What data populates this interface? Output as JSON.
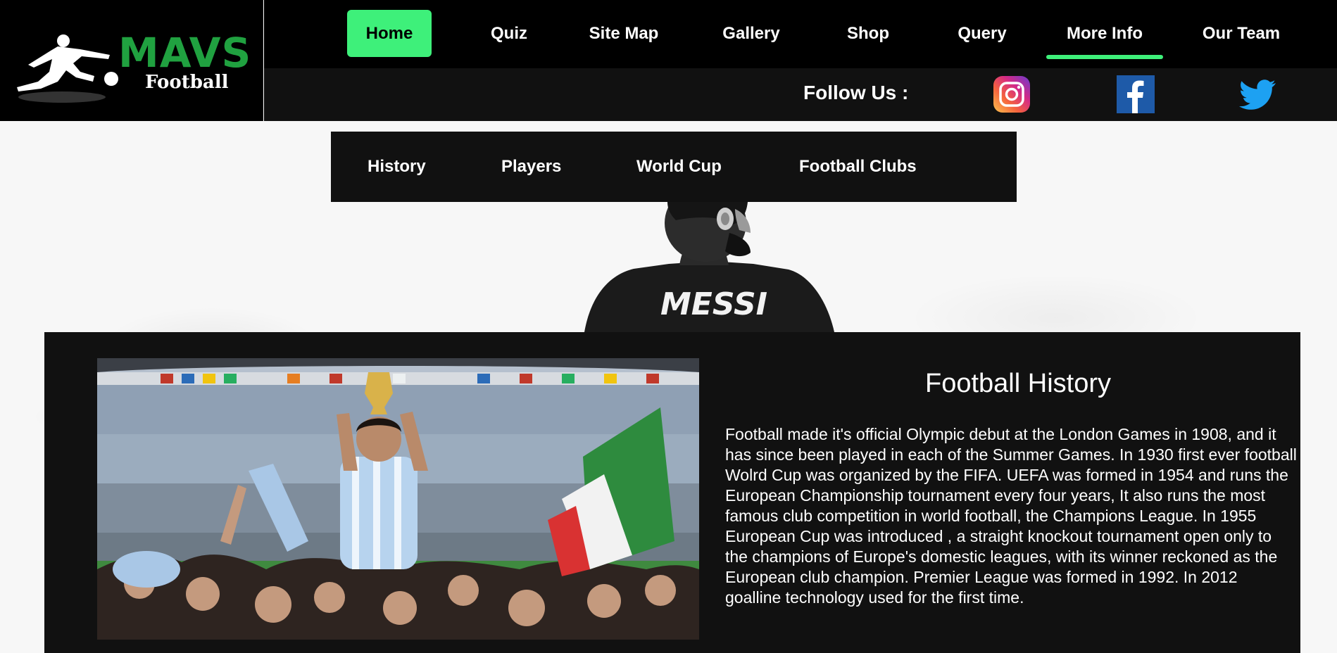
{
  "brand": {
    "title": "MAVS",
    "subtitle": "Football",
    "green": "#20a140"
  },
  "nav": {
    "items": [
      {
        "label": "Home",
        "active": true
      },
      {
        "label": "Quiz"
      },
      {
        "label": "Site Map"
      },
      {
        "label": "Gallery"
      },
      {
        "label": "Shop"
      },
      {
        "label": "Query"
      },
      {
        "label": "More Info",
        "underlined": true
      },
      {
        "label": "Our Team"
      }
    ],
    "accent": "#3ef07a"
  },
  "follow": {
    "label": "Follow Us :",
    "icons": [
      "instagram-icon",
      "facebook-icon",
      "twitter-icon"
    ]
  },
  "subnav": {
    "items": [
      "History",
      "Players",
      "World Cup",
      "Football Clubs"
    ]
  },
  "hero": {
    "jersey_text": "MESSI"
  },
  "content": {
    "title": "Football History",
    "body": "Football made it's official Olympic debut at the London Games in 1908, and it has since been played in each of the Summer Games. In 1930 first ever football Wolrd Cup was organized by the FIFA. UEFA was formed in 1954 and runs the European Championship tournament every four years, It also runs the most famous club competition in world football, the Champions League. In 1955 European Cup was introduced , a straight knockout tournament open only to the champions of Europe's domestic leagues, with its winner reckoned as the European club champion. Premier League was formed in 1992. In 2012 goalline technology used for the first time."
  }
}
